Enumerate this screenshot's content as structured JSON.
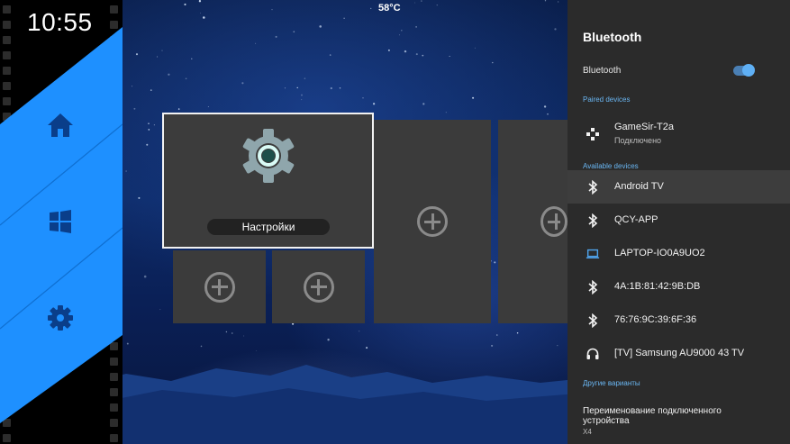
{
  "status": {
    "clock": "10:55",
    "temperature": "58°C"
  },
  "launcher": {
    "nav": [
      {
        "icon": "home-icon"
      },
      {
        "icon": "apps-grid-icon"
      },
      {
        "icon": "gear-icon"
      }
    ],
    "accent_color": "#1e90ff"
  },
  "tiles": {
    "settings": {
      "label": "Настройки",
      "icon": "settings-gear-icon"
    },
    "add_icon": "add-circle-icon"
  },
  "bluetooth_panel": {
    "title": "Bluetooth",
    "toggle": {
      "label": "Bluetooth",
      "on": true
    },
    "paired_header": "Paired devices",
    "paired": [
      {
        "name": "GameSir-T2a",
        "status": "Подключено",
        "icon": "gamepad-icon"
      }
    ],
    "available_header": "Available devices",
    "available": [
      {
        "name": "Android TV",
        "icon": "bluetooth-icon",
        "selected": true
      },
      {
        "name": "QCY-APP",
        "icon": "bluetooth-icon"
      },
      {
        "name": "LAPTOP-IO0A9UO2",
        "icon": "laptop-icon"
      },
      {
        "name": "4A:1B:81:42:9B:DB",
        "icon": "bluetooth-icon"
      },
      {
        "name": "76:76:9C:39:6F:36",
        "icon": "bluetooth-icon"
      },
      {
        "name": "[TV] Samsung AU9000 43 TV",
        "icon": "headphones-icon"
      }
    ],
    "other_header": "Другие варианты",
    "rename": {
      "label": "Переименование подключенного устройства",
      "value": "X4"
    },
    "colors": {
      "panel_bg": "#2b2b2b",
      "accent": "#6ab6f2",
      "selected_row": "#3d3d3d"
    }
  }
}
